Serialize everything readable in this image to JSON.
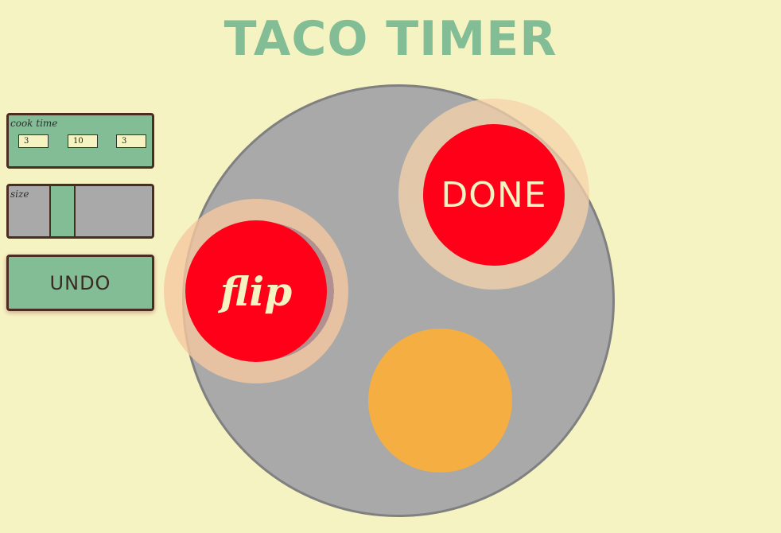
{
  "app": {
    "title": "TACO TIMER"
  },
  "controls": {
    "cook_time": {
      "label": "cook time",
      "values": [
        "3",
        "10",
        "3"
      ]
    },
    "size": {
      "label": "size"
    },
    "undo_label": "UNDO"
  },
  "pan": {
    "flip_label": "flip",
    "done_label": "DONE"
  },
  "colors": {
    "background": "#f6f3c3",
    "accent_green": "#82bd95",
    "button_red": "#ff0018",
    "pan_gray": "#a9a9a9",
    "tortilla_orange": "#f5ae41",
    "border_brown": "#4a2c22"
  }
}
